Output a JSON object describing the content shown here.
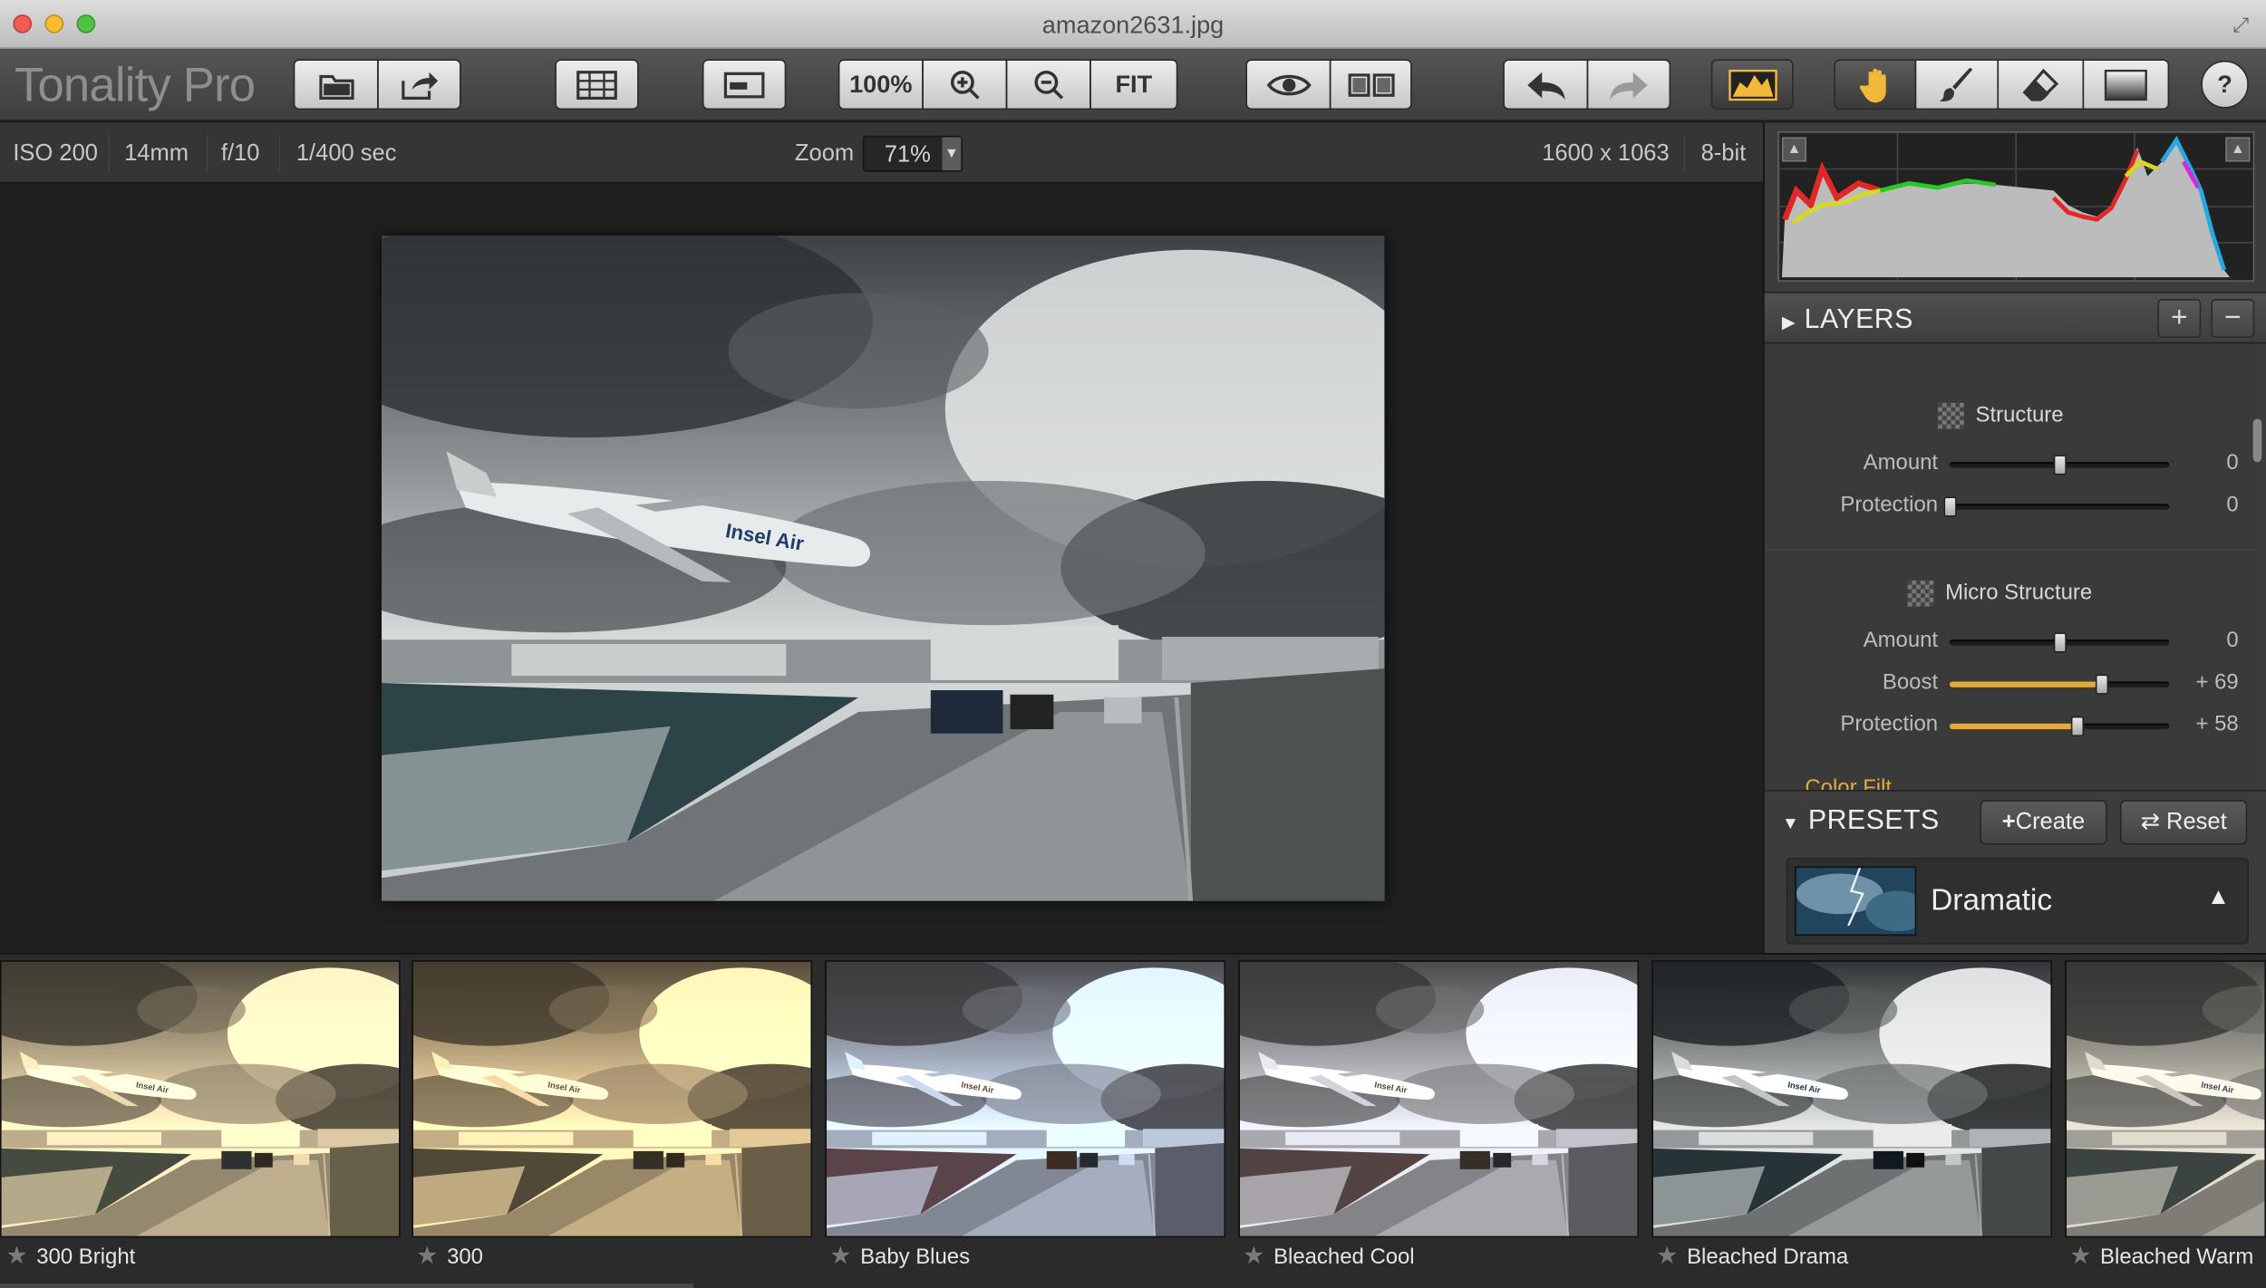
{
  "window": {
    "title": "amazon2631.jpg"
  },
  "app": {
    "name": "Tonality Pro"
  },
  "toolbar": {
    "zoom_100_label": "100%",
    "fit_label": "FIT",
    "help_label": "?",
    "icons": [
      "open-icon",
      "share-icon",
      "batch-icon",
      "layout-icon",
      "zoom-in-icon",
      "zoom-out-icon",
      "preview-eye-icon",
      "compare-icon",
      "undo-icon",
      "redo-icon",
      "histogram-icon",
      "hand-icon",
      "brush-icon",
      "eraser-icon",
      "gradient-icon"
    ],
    "accent_color": "#f2b83a"
  },
  "info": {
    "iso": "ISO 200",
    "focal": "14mm",
    "aperture": "f/10",
    "shutter": "1/400 sec",
    "zoom_label": "Zoom",
    "zoom_value": "71%",
    "dimensions": "1600 x 1063",
    "bitdepth": "8-bit"
  },
  "layers": {
    "title": "LAYERS",
    "add_label": "+",
    "remove_label": "−"
  },
  "adjustments": {
    "structure": {
      "title": "Structure",
      "sliders": [
        {
          "label": "Amount",
          "value": "0",
          "level": 0.5
        },
        {
          "label": "Protection",
          "value": "0",
          "level": 0.0
        }
      ]
    },
    "micro_structure": {
      "title": "Micro Structure",
      "sliders": [
        {
          "label": "Amount",
          "value": "0",
          "level": 0.5
        },
        {
          "label": "Boost",
          "value": "+ 69",
          "level": 0.69
        },
        {
          "label": "Protection",
          "value": "+ 58",
          "level": 0.58
        }
      ]
    },
    "next_section_partial": "Color Filt"
  },
  "presets": {
    "title": "PRESETS",
    "create_label": "Create",
    "reset_label": "Reset",
    "selected": "Dramatic"
  },
  "filmstrip": [
    {
      "label": "300 Bright"
    },
    {
      "label": "300"
    },
    {
      "label": "Baby Blues"
    },
    {
      "label": "Bleached Cool"
    },
    {
      "label": "Bleached Drama"
    },
    {
      "label": "Bleached Warm"
    }
  ]
}
